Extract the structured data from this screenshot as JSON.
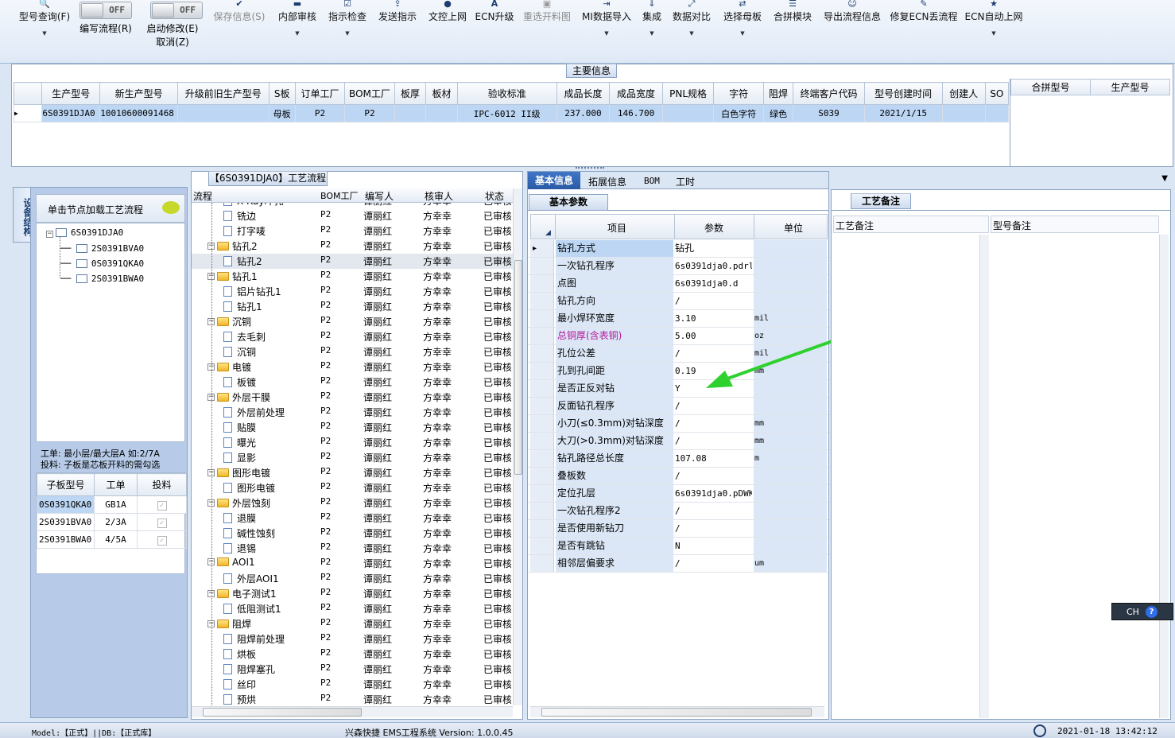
{
  "toolbar": {
    "query_label": "型号查询(F)",
    "toggle1_state": "OFF",
    "toggle1_label": "编写流程(R)",
    "toggle2_state": "OFF",
    "toggle2_label": "启动修改(E)",
    "cancel_label": "取消(Z)",
    "buttons": [
      "保存信息(S)",
      "内部审核",
      "指示检查",
      "发送指示",
      "文控上网",
      "ECN升级",
      "重选开料图",
      "MI数据导入",
      "集成",
      "数据对比",
      "选择母板",
      "合拼模块",
      "导出流程信息",
      "修复ECN丢流程",
      "ECN自动上网"
    ]
  },
  "main_info": {
    "tab": "主要信息",
    "headers": [
      "生产型号",
      "新生产型号",
      "升级前旧生产型号",
      "S板",
      "订单工厂",
      "BOM工厂",
      "板厚",
      "板材",
      "验收标准",
      "成品长度",
      "成品宽度",
      "PNL规格",
      "字符",
      "阻焊",
      "终端客户代码",
      "型号创建时间",
      "创建人",
      "SO"
    ],
    "row": [
      "6S0391DJA0",
      "10010600091468",
      "",
      "母板",
      "P2",
      "P2",
      "",
      "",
      "IPC-6012 II级",
      "237.000",
      "146.700",
      "",
      "白色字符",
      "绿色",
      "S039",
      "2021/1/15",
      "",
      ""
    ],
    "merge_headers": [
      "合拼型号",
      "生产型号"
    ]
  },
  "device": {
    "tab": "设备结构",
    "load_label": "单击节点加载工艺流程",
    "root": "6S0391DJA0",
    "children": [
      "2S0391BVA0",
      "0S0391QKA0",
      "2S0391BWA0"
    ],
    "note1": "工单: 最小层/最大层A 如:2/7A",
    "note2": "投料: 子板是芯板开料的需勾选",
    "sub_headers": [
      "子板型号",
      "工单",
      "投料"
    ],
    "sub_rows": [
      {
        "model": "0S0391QKA0",
        "order": "GB1A"
      },
      {
        "model": "2S0391BVA0",
        "order": "2/3A"
      },
      {
        "model": "2S0391BWA0",
        "order": "4/5A"
      }
    ]
  },
  "flow": {
    "tab": "【6S0391DJA0】工艺流程",
    "headers": [
      "流程",
      "BOM工厂",
      "编写人",
      "核审人",
      "状态"
    ],
    "bom": "P2",
    "writer": "谭丽红",
    "reviewer": "方幸幸",
    "status": "已审核",
    "rows": [
      {
        "name": "X-Ray冲孔",
        "level": 2
      },
      {
        "name": "铣边",
        "level": 2
      },
      {
        "name": "打字唛",
        "level": 2
      },
      {
        "name": "钻孔2",
        "level": 1
      },
      {
        "name": "钻孔2",
        "level": 2
      },
      {
        "name": "钻孔1",
        "level": 1
      },
      {
        "name": "铝片钻孔1",
        "level": 2
      },
      {
        "name": "钻孔1",
        "level": 2
      },
      {
        "name": "沉铜",
        "level": 1
      },
      {
        "name": "去毛刺",
        "level": 2
      },
      {
        "name": "沉铜",
        "level": 2
      },
      {
        "name": "电镀",
        "level": 1
      },
      {
        "name": "板镀",
        "level": 2
      },
      {
        "name": "外层干膜",
        "level": 1
      },
      {
        "name": "外层前处理",
        "level": 2
      },
      {
        "name": "贴膜",
        "level": 2
      },
      {
        "name": "曝光",
        "level": 2
      },
      {
        "name": "显影",
        "level": 2
      },
      {
        "name": "图形电镀",
        "level": 1
      },
      {
        "name": "图形电镀",
        "level": 2
      },
      {
        "name": "外层蚀刻",
        "level": 1
      },
      {
        "name": "退膜",
        "level": 2
      },
      {
        "name": "碱性蚀刻",
        "level": 2
      },
      {
        "name": "退锡",
        "level": 2
      },
      {
        "name": "AOI1",
        "level": 1
      },
      {
        "name": "外层AOI1",
        "level": 2
      },
      {
        "name": "电子测试1",
        "level": 1
      },
      {
        "name": "低阻测试1",
        "level": 2
      },
      {
        "name": "阻焊",
        "level": 1
      },
      {
        "name": "阻焊前处理",
        "level": 2
      },
      {
        "name": "烘板",
        "level": 2
      },
      {
        "name": "阻焊塞孔",
        "level": 2
      },
      {
        "name": "丝印",
        "level": 2
      },
      {
        "name": "预烘",
        "level": 2
      }
    ]
  },
  "basic": {
    "tabs": [
      "基本信息",
      "拓展信息",
      "BOM",
      "工时"
    ],
    "sub_tab": "基本参数",
    "headers": [
      "项目",
      "参数",
      "单位"
    ],
    "rows": [
      {
        "item": "钻孔方式",
        "param": "钻孔",
        "unit": ""
      },
      {
        "item": "一次钻孔程序",
        "param": "6s0391dja0.pdrl",
        "unit": ""
      },
      {
        "item": "点图",
        "param": "6s0391dja0.d",
        "unit": ""
      },
      {
        "item": "钻孔方向",
        "param": "/",
        "unit": ""
      },
      {
        "item": "最小焊环宽度",
        "param": "3.10",
        "unit": "mil"
      },
      {
        "item": "总铜厚(含表铜)",
        "param": "5.00",
        "unit": "oz"
      },
      {
        "item": "孔位公差",
        "param": "/",
        "unit": "mil"
      },
      {
        "item": "孔到孔间距",
        "param": "0.19",
        "unit": "mm"
      },
      {
        "item": "是否正反对钻",
        "param": "Y",
        "unit": ""
      },
      {
        "item": "反面钻孔程序",
        "param": "/",
        "unit": ""
      },
      {
        "item": "小刀(≤0.3mm)对钻深度",
        "param": "/",
        "unit": "mm"
      },
      {
        "item": "大刀(>0.3mm)对钻深度",
        "param": "/",
        "unit": "mm"
      },
      {
        "item": "钻孔路径总长度",
        "param": "107.08",
        "unit": "m"
      },
      {
        "item": "叠板数",
        "param": "/",
        "unit": ""
      },
      {
        "item": "定位孔层",
        "param": "6s0391dja0.pDWK",
        "unit": ""
      },
      {
        "item": "一次钻孔程序2",
        "param": "/",
        "unit": ""
      },
      {
        "item": "是否使用新钻刀",
        "param": "/",
        "unit": ""
      },
      {
        "item": "是否有跳钻",
        "param": "N",
        "unit": ""
      },
      {
        "item": "相邻层偏要求",
        "param": "/",
        "unit": "um"
      }
    ],
    "highlight_color": "#b4189a"
  },
  "remarks": {
    "tab": "工艺备注",
    "headers": [
      "工艺备注",
      "型号备注"
    ]
  },
  "ime": {
    "label": "CH"
  },
  "status": {
    "model_db": "Model:【正式】||DB:【正式库】",
    "system": "兴森快捷 EMS工程系统 Version: 1.0.0.45",
    "datetime": "2021-01-18 13:42:12"
  }
}
